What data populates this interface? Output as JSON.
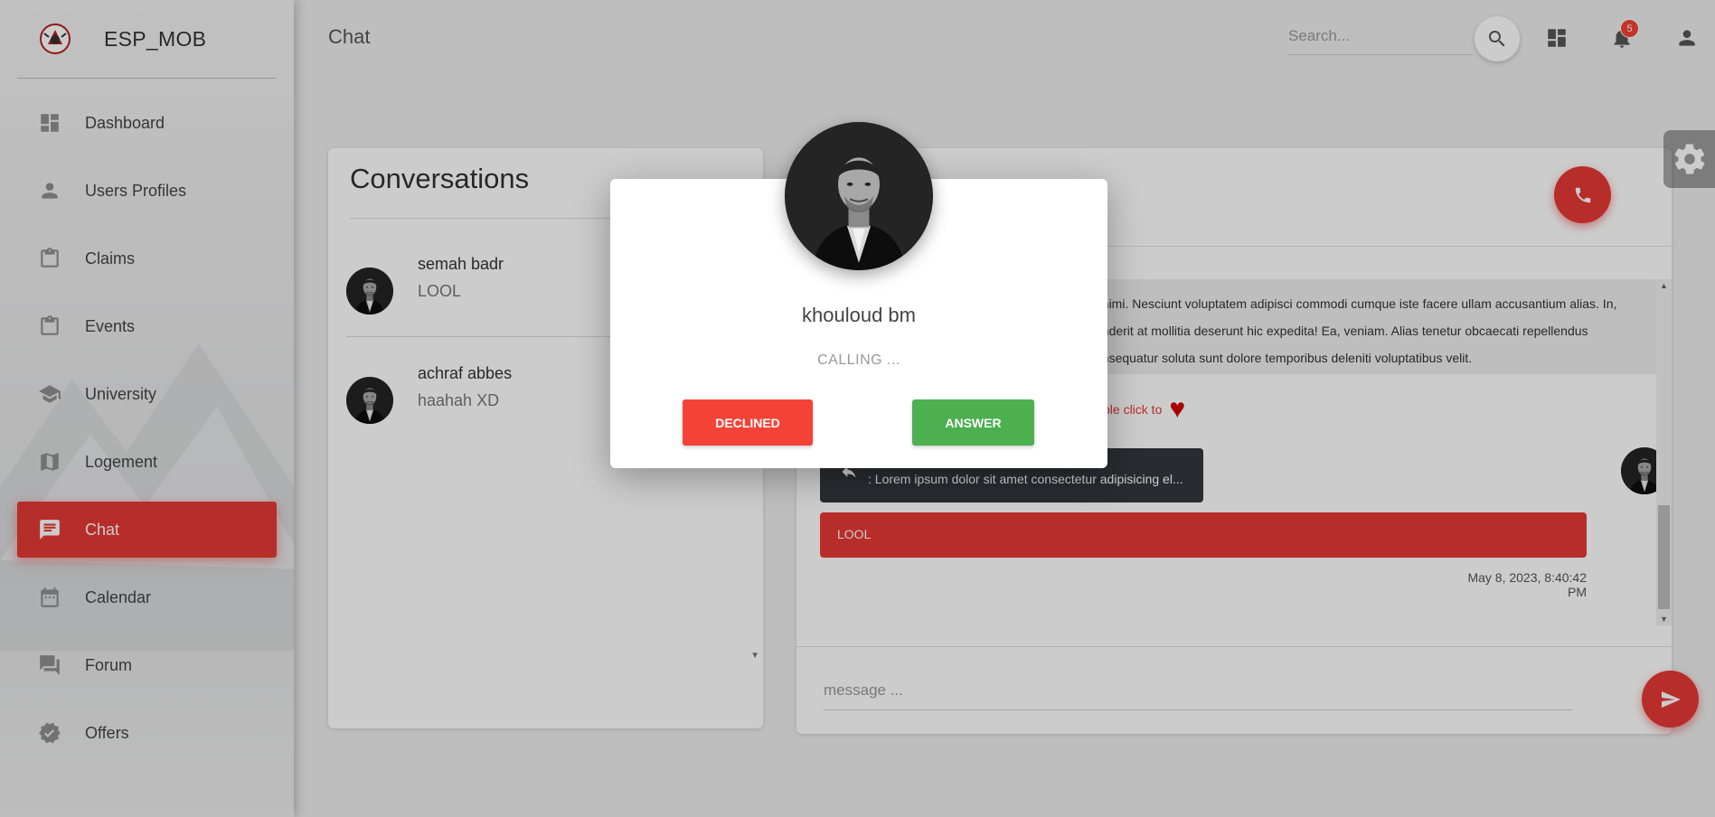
{
  "app": {
    "brand": "ESP_MOB",
    "page_title": "Chat"
  },
  "sidebar": {
    "items": [
      {
        "label": "Dashboard",
        "icon": "dashboard-icon"
      },
      {
        "label": "Users Profiles",
        "icon": "person-icon"
      },
      {
        "label": "Claims",
        "icon": "clipboard-icon"
      },
      {
        "label": "Events",
        "icon": "clipboard-icon"
      },
      {
        "label": "University",
        "icon": "school-icon"
      },
      {
        "label": "Logement",
        "icon": "map-icon"
      },
      {
        "label": "Chat",
        "icon": "chat-icon",
        "active": true
      },
      {
        "label": "Calendar",
        "icon": "calendar-icon"
      },
      {
        "label": "Forum",
        "icon": "forum-icon"
      },
      {
        "label": "Offers",
        "icon": "verified-icon"
      }
    ]
  },
  "topbar": {
    "search_placeholder": "Search...",
    "notification_count": "5"
  },
  "conversations": {
    "title": "Conversations",
    "items": [
      {
        "name": "semah badr",
        "last_message": "LOOL"
      },
      {
        "name": "achraf abbes",
        "last_message": "haahah XD"
      }
    ]
  },
  "chat": {
    "long_message": "animi. Nesciunt voluptatem adipisci commodi cumque iste facere ullam accusantium alias. In, enderit at mollitia deserunt hic expedita! Ea, veniam. Alias tenetur obcaecati repellendus onsequatur soluta sunt dolore temporibus deleniti voluptatibus velit.",
    "like_hint": "ble click to",
    "reply_preview": ": Lorem ipsum dolor sit amet consectetur adipisicing el...",
    "message": "LOOL",
    "timestamp": "May 8, 2023, 8:40:42 PM",
    "input_placeholder": "message ..."
  },
  "call_modal": {
    "caller": "khouloud bm",
    "status": "CALLING ...",
    "decline_label": "DECLINED",
    "answer_label": "ANSWER"
  },
  "colors": {
    "accent": "#e53935",
    "decline": "#f44336",
    "answer": "#4caf50",
    "dark_bubble": "#33373c"
  }
}
